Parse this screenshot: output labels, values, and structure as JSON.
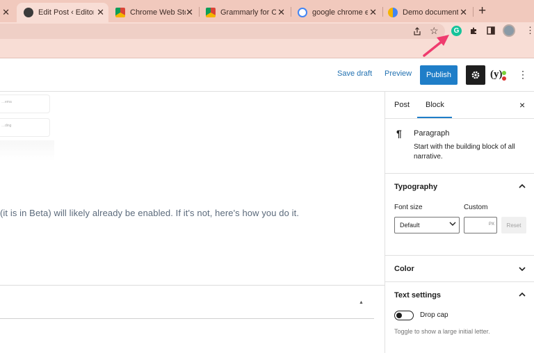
{
  "browser": {
    "tabs": [
      {
        "title": "",
        "icon": "wordpress-blue-icon",
        "partial": true
      },
      {
        "title": "Edit Post ‹ EditorF",
        "icon": "wordpress-icon",
        "active": true
      },
      {
        "title": "Chrome Web Stor",
        "icon": "chrome-web-store-icon"
      },
      {
        "title": "Grammarly for Ch",
        "icon": "chrome-web-store-icon"
      },
      {
        "title": "google chrome ex",
        "icon": "google-icon"
      },
      {
        "title": "Demo document",
        "icon": "google-docs-icon"
      }
    ],
    "close_glyph": "✕",
    "new_tab_glyph": "+",
    "grammarly_letter": "G"
  },
  "editor_header": {
    "save_draft": "Save draft",
    "preview": "Preview",
    "publish": "Publish",
    "yoast": "(y)"
  },
  "content": {
    "ghost_cards": [
      "…ema",
      "…ding"
    ],
    "paragraph": "(it is in Beta) will likely already be enabled. If it's not, here's how you do it."
  },
  "sidebar": {
    "tabs": [
      "Post",
      "Block"
    ],
    "active_tab": "Block",
    "close": "×",
    "block": {
      "title": "Paragraph",
      "description": "Start with the building block of all narrative."
    },
    "typography": {
      "title": "Typography",
      "font_size_label": "Font size",
      "custom_label": "Custom",
      "select_value": "Default",
      "unit": "PX",
      "reset": "Reset"
    },
    "color": {
      "title": "Color"
    },
    "text_settings": {
      "title": "Text settings",
      "drop_cap": "Drop cap",
      "help": "Toggle to show a large initial letter."
    }
  },
  "colors": {
    "accent": "#1f7ec8",
    "arrow": "#ef3b6e",
    "grammarly": "#15c39a"
  }
}
